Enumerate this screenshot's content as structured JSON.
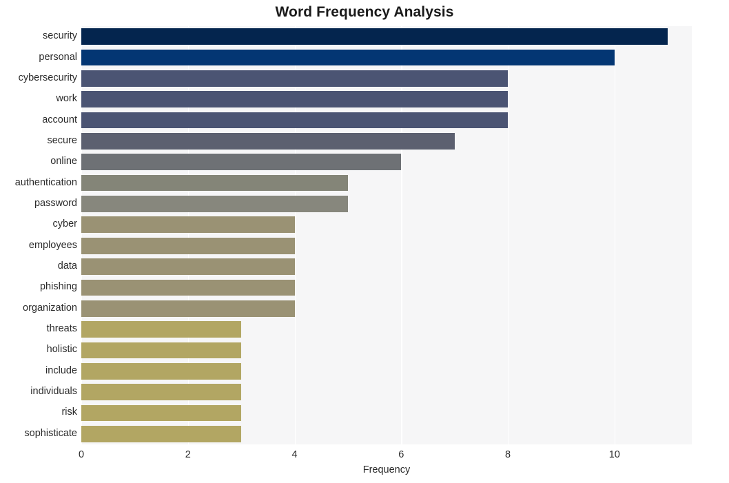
{
  "chart_data": {
    "type": "bar",
    "orientation": "horizontal",
    "title": "Word Frequency Analysis",
    "xlabel": "Frequency",
    "ylabel": "",
    "categories": [
      "security",
      "personal",
      "cybersecurity",
      "work",
      "account",
      "secure",
      "online",
      "authentication",
      "password",
      "cyber",
      "employees",
      "data",
      "phishing",
      "organization",
      "threats",
      "holistic",
      "include",
      "individuals",
      "risk",
      "sophisticate"
    ],
    "values": [
      11,
      10,
      8,
      8,
      8,
      7,
      6,
      5,
      5,
      4,
      4,
      4,
      4,
      4,
      3,
      3,
      3,
      3,
      3,
      3
    ],
    "bar_colors": [
      "#04254e",
      "#033673",
      "#4b5473",
      "#4b5473",
      "#4b5473",
      "#5c6070",
      "#6e7175",
      "#848578",
      "#87877d",
      "#9a9274",
      "#9a9274",
      "#9a9274",
      "#9a9274",
      "#9a9274",
      "#b2a663",
      "#b2a663",
      "#b2a663",
      "#b2a663",
      "#b2a663",
      "#b2a663"
    ],
    "xlim": [
      0,
      11.45
    ],
    "xticks": [
      0,
      2,
      4,
      6,
      8,
      10
    ],
    "xtick_labels": [
      "0",
      "2",
      "4",
      "6",
      "8",
      "10"
    ],
    "grid": true,
    "grid_axis": "x",
    "grid_color": "#ffffff",
    "plot_background": "#f6f6f7",
    "figure_background": "#ffffff",
    "legend": null
  }
}
